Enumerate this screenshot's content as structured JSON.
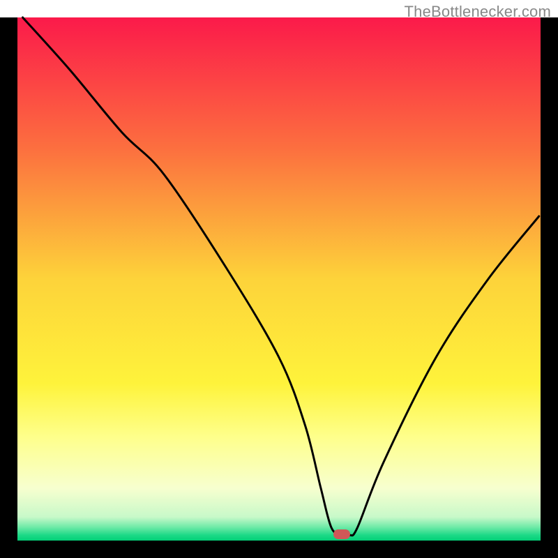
{
  "attribution": "TheBottlenecker.com",
  "chart_data": {
    "type": "line",
    "title": "",
    "xlabel": "",
    "ylabel": "",
    "xlim": [
      0,
      100
    ],
    "ylim": [
      0,
      100
    ],
    "x": [
      1,
      10,
      20,
      28,
      40,
      50,
      55,
      58,
      60,
      62,
      63.5,
      65,
      70,
      80,
      90,
      99.7
    ],
    "values": [
      100,
      90,
      78,
      70,
      52,
      35,
      22,
      10,
      2.5,
      1,
      1,
      2.5,
      15,
      35,
      50,
      62
    ],
    "marker": {
      "x": 62,
      "y": 1.2,
      "color": "#d05858"
    },
    "background": {
      "type": "vertical-gradient",
      "stops": [
        {
          "pos": 0,
          "color": "#fb1a4a"
        },
        {
          "pos": 0.25,
          "color": "#fc6f3f"
        },
        {
          "pos": 0.5,
          "color": "#fdd33a"
        },
        {
          "pos": 0.7,
          "color": "#fef33b"
        },
        {
          "pos": 0.8,
          "color": "#feff8a"
        },
        {
          "pos": 0.9,
          "color": "#f7ffcf"
        },
        {
          "pos": 0.955,
          "color": "#c8f9c9"
        },
        {
          "pos": 0.975,
          "color": "#6be9a6"
        },
        {
          "pos": 0.99,
          "color": "#1bd986"
        },
        {
          "pos": 1.0,
          "color": "#03cf77"
        }
      ]
    },
    "frame_color": "#000000",
    "curve_color": "#000000",
    "curve_width": 3
  }
}
